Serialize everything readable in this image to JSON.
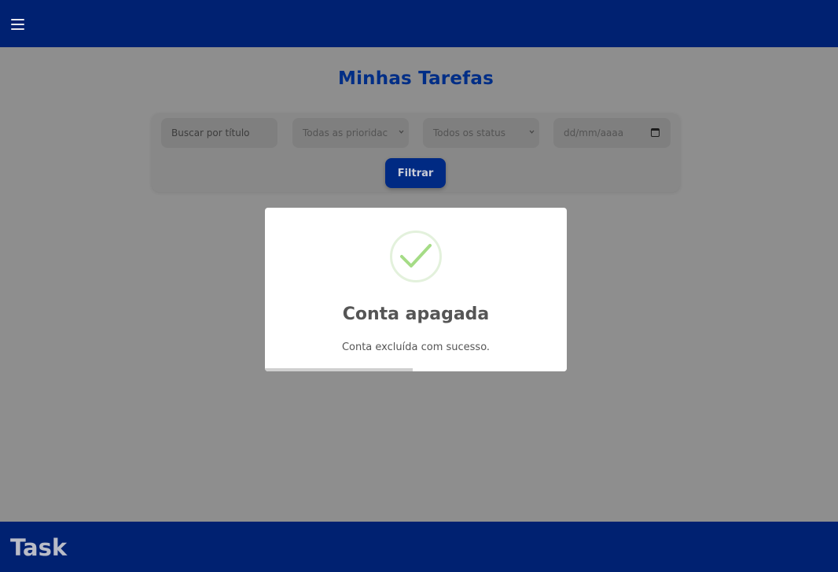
{
  "header": {
    "menu_icon": "hamburger-menu-icon"
  },
  "main": {
    "title": "Minhas Tarefas"
  },
  "filters": {
    "search_placeholder": "Buscar por título",
    "priority_selected": "Todas as prioridac",
    "status_selected": "Todos os status",
    "date_placeholder": "dd/mm/aaaa",
    "submit_label": "Filtrar"
  },
  "modal": {
    "icon": "success-check-icon",
    "title": "Conta apagada",
    "message": "Conta excluída com sucesso.",
    "timer_progress": 0.49
  },
  "footer": {
    "brand": "Task"
  },
  "colors": {
    "navy": "#002171",
    "accent": "#002e86",
    "success": "#a5dc86",
    "backdrop": "#8e8e8e"
  }
}
